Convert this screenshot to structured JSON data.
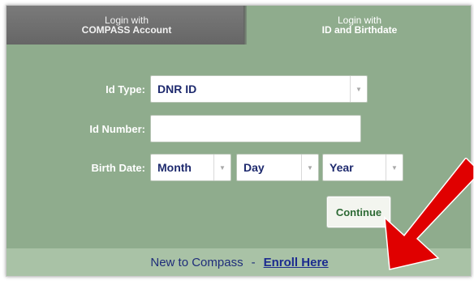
{
  "tabs": [
    {
      "line1": "Login with",
      "line2": "COMPASS Account"
    },
    {
      "line1": "Login with",
      "line2": "ID and Birthdate"
    }
  ],
  "form": {
    "id_type": {
      "label": "Id Type:",
      "value": "DNR ID"
    },
    "id_number": {
      "label": "Id Number:",
      "value": ""
    },
    "birth_date": {
      "label": "Birth Date:",
      "month": "Month",
      "day": "Day",
      "year": "Year"
    },
    "continue_label": "Continue"
  },
  "footer": {
    "text": "New to Compass",
    "separator": "-",
    "link": "Enroll Here"
  },
  "colors": {
    "panel": "#8fac8d",
    "footer": "#a9c2a6",
    "inactive_tab": "#6f6f6f",
    "link": "#1b2a8f",
    "arrow": "#e00000"
  },
  "icons": [
    "dropdown-caret-icon",
    "red-arrow-icon"
  ]
}
